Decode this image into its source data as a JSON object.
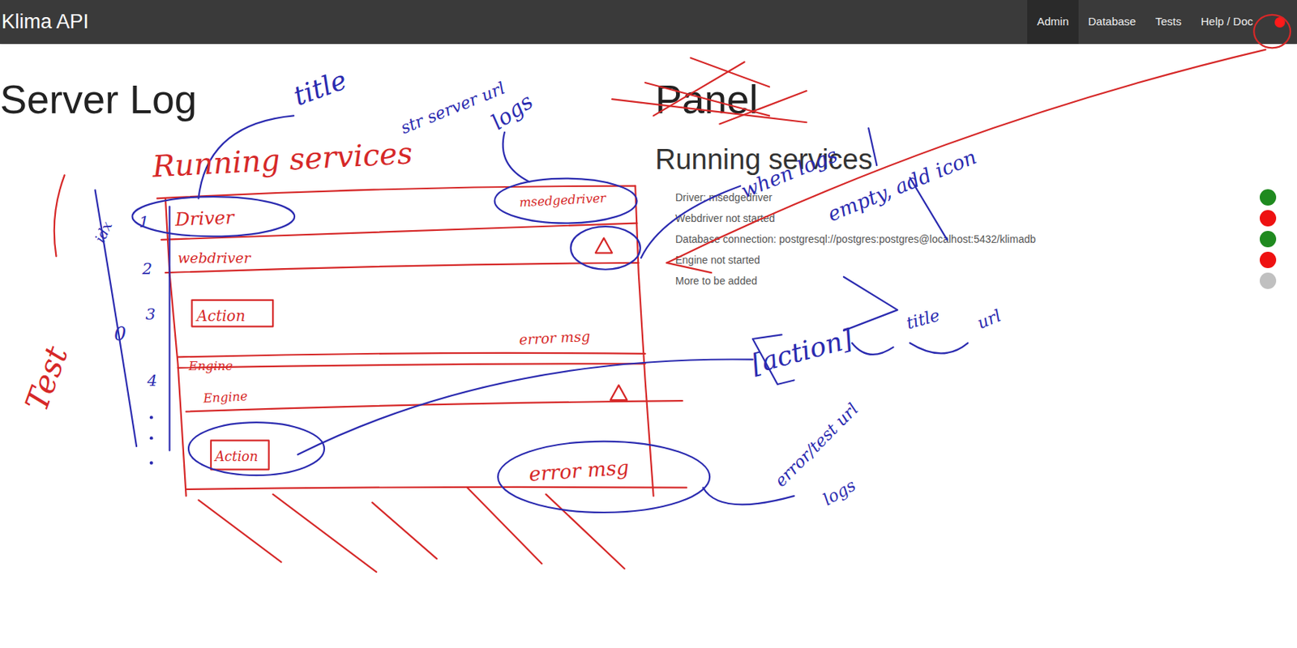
{
  "app": {
    "title": "Klima API"
  },
  "nav": [
    {
      "label": "Admin",
      "selected": true
    },
    {
      "label": "Database",
      "selected": false
    },
    {
      "label": "Tests",
      "selected": false
    },
    {
      "label": "Help / Doc",
      "selected": false
    }
  ],
  "nav_alert": {
    "color": "#ff1a1a"
  },
  "server_log": {
    "title": "Server Log"
  },
  "panel": {
    "title": "Panel",
    "subtitle": "Running services",
    "services": [
      {
        "text": "Driver: msedgedriver",
        "color": "#1f8a1f"
      },
      {
        "text": "Webdriver not started",
        "color": "#ee1111"
      },
      {
        "text": "Database connection: postgresql://postgres:postgres@localhost:5432/klimadb",
        "color": "#1f8a1f"
      },
      {
        "text": "Engine not started",
        "color": "#ee1111"
      },
      {
        "text": "More to be added",
        "color": "#c0c0c0"
      }
    ]
  },
  "annotations": [
    {
      "text": "Running services",
      "color": "#d62828"
    },
    {
      "text": "msedgedriver",
      "color": "#d62828"
    },
    {
      "text": "Driver",
      "color": "#d62828"
    },
    {
      "text": "webdriver",
      "color": "#d62828"
    },
    {
      "text": "Action",
      "color": "#d62828"
    },
    {
      "text": "error msg",
      "color": "#d62828"
    },
    {
      "text": "Engine",
      "color": "#d62828"
    },
    {
      "text": "Engine",
      "color": "#d62828"
    },
    {
      "text": "Action",
      "color": "#d62828"
    },
    {
      "text": "error msg",
      "color": "#d62828"
    },
    {
      "text": "Test",
      "color": "#d62828"
    },
    {
      "text": "title",
      "color": "#2b2bb0"
    },
    {
      "text": "str server url",
      "color": "#2b2bb0"
    },
    {
      "text": "logs",
      "color": "#2b2bb0"
    },
    {
      "text": "idx",
      "color": "#2b2bb0"
    },
    {
      "text": "1",
      "color": "#2b2bb0"
    },
    {
      "text": "2",
      "color": "#2b2bb0"
    },
    {
      "text": "3",
      "color": "#2b2bb0"
    },
    {
      "text": "4",
      "color": "#2b2bb0"
    },
    {
      "text": "0",
      "color": "#2b2bb0"
    },
    {
      "text": "when logs",
      "color": "#2b2bb0"
    },
    {
      "text": "empty, add icon",
      "color": "#2b2bb0"
    },
    {
      "text": "[action]",
      "color": "#2b2bb0"
    },
    {
      "text": "title",
      "color": "#2b2bb0"
    },
    {
      "text": "url",
      "color": "#2b2bb0"
    },
    {
      "text": "error/test url",
      "color": "#2b2bb0"
    },
    {
      "text": "logs",
      "color": "#2b2bb0"
    }
  ]
}
